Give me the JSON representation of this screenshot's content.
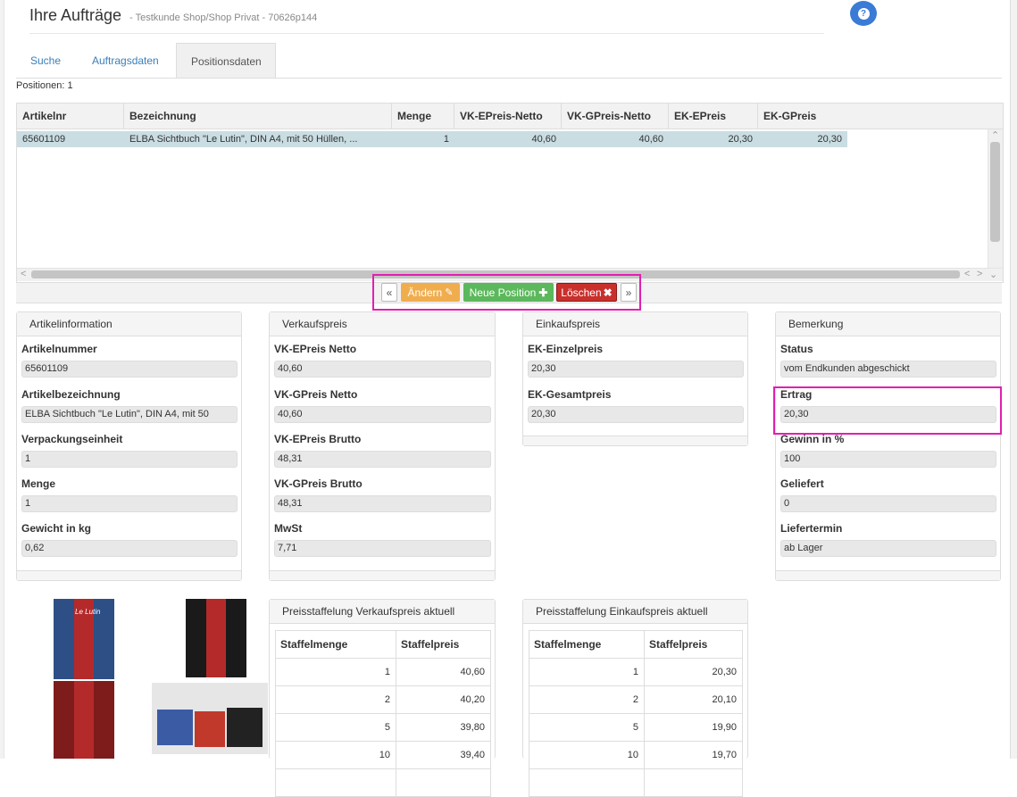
{
  "header": {
    "title": "Ihre Aufträge",
    "subtitle": "- Testkunde Shop/Shop Privat - 70626p144",
    "help_icon": "?"
  },
  "tabs": [
    {
      "label": "Suche"
    },
    {
      "label": "Auftragsdaten"
    },
    {
      "label": "Positionsdaten"
    }
  ],
  "positions_count": "Positionen: 1",
  "grid": {
    "columns": [
      "Artikelnr",
      "Bezeichnung",
      "Menge",
      "VK-EPreis-Netto",
      "VK-GPreis-Netto",
      "EK-EPreis",
      "EK-GPreis"
    ],
    "rows": [
      {
        "artikelnr": "65601109",
        "bezeichnung": "ELBA Sichtbuch \"Le Lutin\", DIN A4, mit 50 Hüllen, ...",
        "menge": "1",
        "vk_e_netto": "40,60",
        "vk_g_netto": "40,60",
        "ek_e": "20,30",
        "ek_g": "20,30"
      }
    ]
  },
  "actions": {
    "prev": "«",
    "edit": "Ändern",
    "new": "Neue Position",
    "delete": "Löschen",
    "next": "»",
    "colors": {
      "edit": "#f0ad4e",
      "new": "#5cb85c",
      "delete": "#c9302c"
    }
  },
  "panels": {
    "artikel": {
      "title": "Artikelinformation",
      "fields": [
        {
          "label": "Artikelnummer",
          "value": "65601109"
        },
        {
          "label": "Artikelbezeichnung",
          "value": "ELBA Sichtbuch \"Le Lutin\", DIN A4, mit 50"
        },
        {
          "label": "Verpackungseinheit",
          "value": "1"
        },
        {
          "label": "Menge",
          "value": "1"
        },
        {
          "label": "Gewicht in kg",
          "value": "0,62"
        }
      ]
    },
    "verkauf": {
      "title": "Verkaufspreis",
      "fields": [
        {
          "label": "VK-EPreis Netto",
          "value": "40,60"
        },
        {
          "label": "VK-GPreis Netto",
          "value": "40,60"
        },
        {
          "label": "VK-EPreis Brutto",
          "value": "48,31"
        },
        {
          "label": "VK-GPreis Brutto",
          "value": "48,31"
        },
        {
          "label": "MwSt",
          "value": "7,71"
        }
      ]
    },
    "einkauf": {
      "title": "Einkaufspreis",
      "fields": [
        {
          "label": "EK-Einzelpreis",
          "value": "20,30"
        },
        {
          "label": "EK-Gesamtpreis",
          "value": "20,30"
        }
      ]
    },
    "bemerkung": {
      "title": "Bemerkung",
      "fields": [
        {
          "label": "Status",
          "value": "vom Endkunden abgeschickt"
        },
        {
          "label": "Ertrag",
          "value": "20,30"
        },
        {
          "label": "Gewinn in %",
          "value": "100"
        },
        {
          "label": "Geliefert",
          "value": "0"
        },
        {
          "label": "Liefertermin",
          "value": "ab Lager"
        }
      ]
    }
  },
  "staffel_vk": {
    "title": "Preisstaffelung Verkaufspreis aktuell",
    "headers": [
      "Staffelmenge",
      "Staffelpreis"
    ],
    "rows": [
      [
        "1",
        "40,60"
      ],
      [
        "2",
        "40,20"
      ],
      [
        "5",
        "39,80"
      ],
      [
        "10",
        "39,40"
      ],
      [
        "",
        ""
      ]
    ]
  },
  "staffel_ek": {
    "title": "Preisstaffelung Einkaufspreis aktuell",
    "headers": [
      "Staffelmenge",
      "Staffelpreis"
    ],
    "rows": [
      [
        "1",
        "20,30"
      ],
      [
        "2",
        "20,10"
      ],
      [
        "5",
        "19,90"
      ],
      [
        "10",
        "19,70"
      ],
      [
        "",
        ""
      ]
    ]
  },
  "product_images": {
    "brand_text": "Le Lutin",
    "colors": {
      "blue": "#2d4f86",
      "red": "#b42a2a",
      "dark_red": "#7e1c1c",
      "black": "#1a1a1a"
    }
  },
  "highlight_color": "#e020b0"
}
